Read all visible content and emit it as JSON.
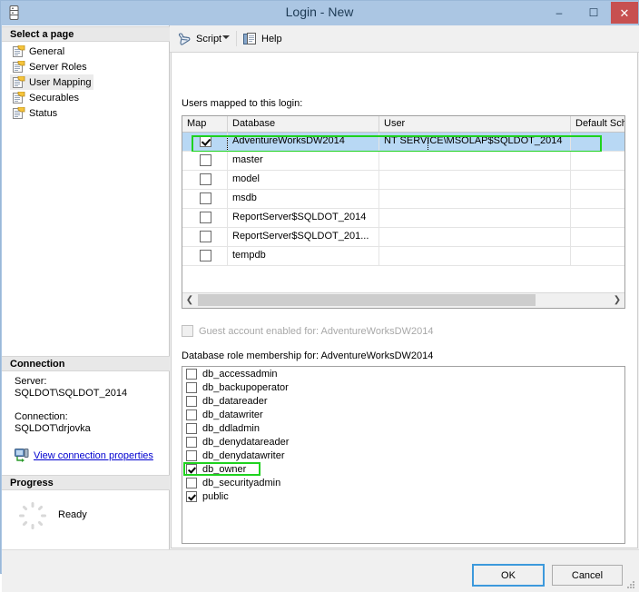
{
  "window": {
    "title": "Login - New",
    "icon": "server-icon",
    "controls": {
      "minimize": "–",
      "maximize": "☐",
      "close": "✕"
    }
  },
  "sidebar": {
    "select_page_header": "Select a page",
    "pages": [
      {
        "label": "General",
        "selected": false
      },
      {
        "label": "Server Roles",
        "selected": false
      },
      {
        "label": "User Mapping",
        "selected": true
      },
      {
        "label": "Securables",
        "selected": false
      },
      {
        "label": "Status",
        "selected": false
      }
    ],
    "connection_header": "Connection",
    "server_label": "Server:",
    "server_value": "SQLDOT\\SQLDOT_2014",
    "connection_label": "Connection:",
    "connection_value": "SQLDOT\\drjovka",
    "view_connection_link": "View connection properties",
    "progress_header": "Progress",
    "progress_status": "Ready"
  },
  "toolbar": {
    "script_label": "Script",
    "script_icon": "script-icon",
    "dropdown_icon": "chevron-down-icon",
    "help_label": "Help",
    "help_icon": "help-icon"
  },
  "main": {
    "users_label": "Users mapped to this login:",
    "grid": {
      "columns": [
        "Map",
        "Database",
        "User",
        "Default Sch"
      ],
      "rows": [
        {
          "map": true,
          "database": "AdventureWorksDW2014",
          "user": "NT SERVICE\\MSOLAP$SQLDOT_2014",
          "default_schema": "",
          "selected": true,
          "highlighted": true
        },
        {
          "map": false,
          "database": "master",
          "user": "",
          "default_schema": "",
          "selected": false,
          "highlighted": false
        },
        {
          "map": false,
          "database": "model",
          "user": "",
          "default_schema": "",
          "selected": false,
          "highlighted": false
        },
        {
          "map": false,
          "database": "msdb",
          "user": "",
          "default_schema": "",
          "selected": false,
          "highlighted": false
        },
        {
          "map": false,
          "database": "ReportServer$SQLDOT_2014",
          "user": "",
          "default_schema": "",
          "selected": false,
          "highlighted": false
        },
        {
          "map": false,
          "database": "ReportServer$SQLDOT_201...",
          "user": "",
          "default_schema": "",
          "selected": false,
          "highlighted": false
        },
        {
          "map": false,
          "database": "tempdb",
          "user": "",
          "default_schema": "",
          "selected": false,
          "highlighted": false
        }
      ],
      "scroll_left_icon": "chevron-left-icon",
      "scroll_right_icon": "chevron-right-icon"
    },
    "guest_account_label": "Guest account enabled for: AdventureWorksDW2014",
    "guest_account_checked": false,
    "roles_label": "Database role membership for: AdventureWorksDW2014",
    "roles": [
      {
        "label": "db_accessadmin",
        "checked": false,
        "highlighted": false
      },
      {
        "label": "db_backupoperator",
        "checked": false,
        "highlighted": false
      },
      {
        "label": "db_datareader",
        "checked": false,
        "highlighted": false
      },
      {
        "label": "db_datawriter",
        "checked": false,
        "highlighted": false
      },
      {
        "label": "db_ddladmin",
        "checked": false,
        "highlighted": false
      },
      {
        "label": "db_denydatareader",
        "checked": false,
        "highlighted": false
      },
      {
        "label": "db_denydatawriter",
        "checked": false,
        "highlighted": false
      },
      {
        "label": "db_owner",
        "checked": true,
        "highlighted": true
      },
      {
        "label": "db_securityadmin",
        "checked": false,
        "highlighted": false
      },
      {
        "label": "public",
        "checked": true,
        "highlighted": false
      }
    ]
  },
  "footer": {
    "ok_label": "OK",
    "cancel_label": "Cancel"
  },
  "colors": {
    "titlebar": "#abc6e3",
    "close_button": "#c75050",
    "highlight_green": "#1fd21f",
    "row_selected": "#b8d8f4",
    "link": "#0000d0",
    "focus_border": "#3c99dc"
  }
}
